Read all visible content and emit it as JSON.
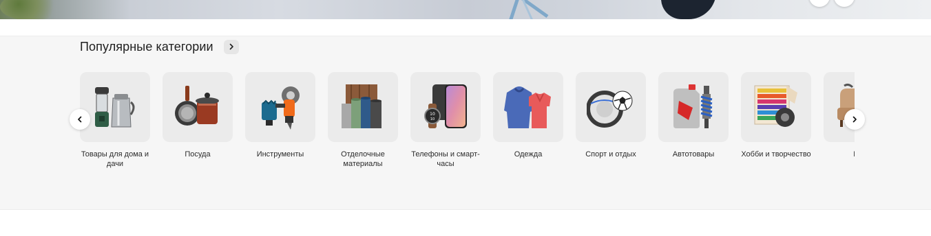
{
  "section": {
    "title": "Популярные категории"
  },
  "categories": [
    {
      "label": "Товары для дома и дачи",
      "icon": "lantern-kettle-icon"
    },
    {
      "label": "Посуда",
      "icon": "cookware-icon"
    },
    {
      "label": "Инструменты",
      "icon": "power-tools-icon"
    },
    {
      "label": "Отделочные материалы",
      "icon": "wallpaper-rolls-icon"
    },
    {
      "label": "Телефоны и смарт-часы",
      "icon": "phone-watch-icon"
    },
    {
      "label": "Одежда",
      "icon": "clothing-icon"
    },
    {
      "label": "Спорт и отдых",
      "icon": "unicycle-ball-icon"
    },
    {
      "label": "Автотовары",
      "icon": "motor-oil-shock-icon"
    },
    {
      "label": "Хобби и творчество",
      "icon": "plasticine-icon"
    },
    {
      "label": "Ме",
      "icon": "furniture-icon"
    }
  ],
  "colors": {
    "section_bg": "#f6f6f6",
    "tile_bg": "#ebebeb",
    "text": "#1f1f1f"
  }
}
